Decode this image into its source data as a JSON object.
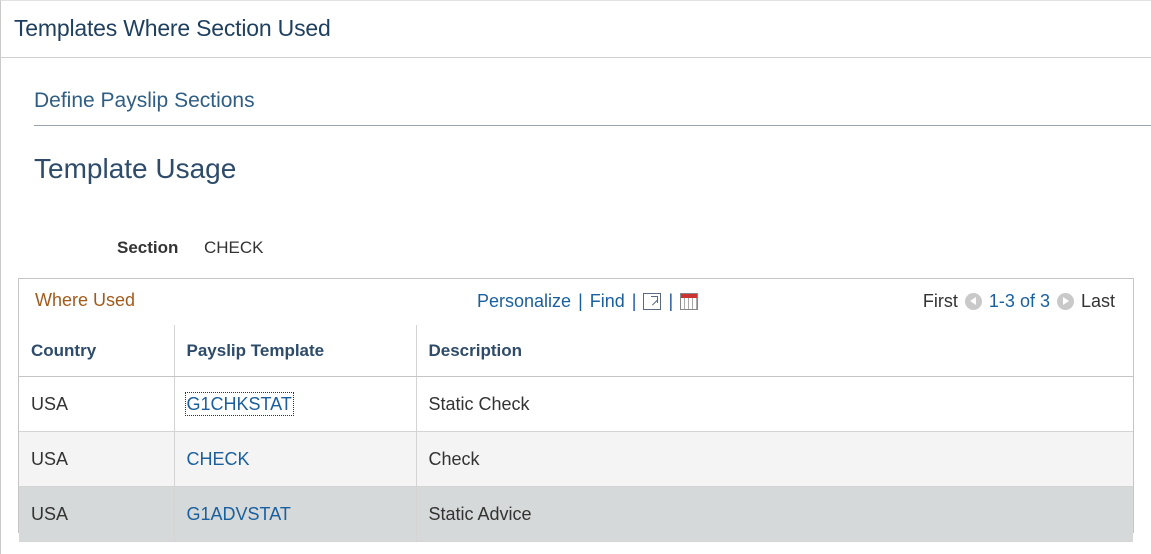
{
  "window": {
    "title": "Templates Where Section Used"
  },
  "tab": {
    "title": "Define Payslip Sections"
  },
  "page": {
    "heading": "Template Usage"
  },
  "section": {
    "label": "Section",
    "value": "CHECK"
  },
  "grid": {
    "title": "Where Used",
    "personalize_label": "Personalize",
    "separator": "|",
    "find_label": "Find",
    "zoom_icon": "zoom-icon",
    "download_icon": "download-excel-icon",
    "first_label": "First",
    "range_label": "1-3 of 3",
    "last_label": "Last",
    "columns": [
      "Country",
      "Payslip Template",
      "Description"
    ],
    "rows": [
      {
        "country": "USA",
        "template": "G1CHKSTAT",
        "description": "Static Check"
      },
      {
        "country": "USA",
        "template": "CHECK",
        "description": "Check"
      },
      {
        "country": "USA",
        "template": "G1ADVSTAT",
        "description": "Static Advice"
      }
    ]
  },
  "colors": {
    "link": "#1a5f9e",
    "grid_title": "#a35b1c",
    "selected_row": "#d6d9d9"
  }
}
